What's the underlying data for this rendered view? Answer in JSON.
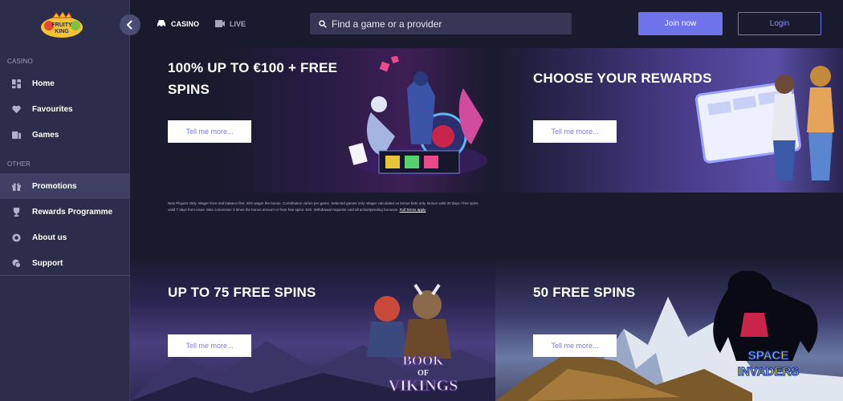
{
  "brand": {
    "logo_text": "FRUITY KING"
  },
  "sidebar": {
    "sections": [
      {
        "label": "CASINO"
      },
      {
        "label": "OTHER"
      }
    ],
    "items": [
      {
        "label": "Home",
        "icon": "grid-icon"
      },
      {
        "label": "Favourites",
        "icon": "heart-icon"
      },
      {
        "label": "Games",
        "icon": "games-icon"
      },
      {
        "label": "Promotions",
        "icon": "gift-icon",
        "active": true
      },
      {
        "label": "Rewards Programme",
        "icon": "trophy-icon"
      },
      {
        "label": "About us",
        "icon": "info-icon"
      },
      {
        "label": "Support",
        "icon": "support-icon"
      }
    ]
  },
  "header": {
    "tabs": [
      {
        "label": "CASINO",
        "icon": "car-icon"
      },
      {
        "label": "LIVE",
        "icon": "live-icon"
      }
    ],
    "search": {
      "placeholder": "Find a game or a provider"
    },
    "join_label": "Join now",
    "login_label": "Login"
  },
  "promos": [
    {
      "title": "100% UP TO €100 + FREE SPINS",
      "button": "Tell me more..."
    },
    {
      "title": "CHOOSE YOUR REWARDS",
      "button": "Tell me more..."
    },
    {
      "title": "UP TO 75 FREE SPINS",
      "button": "Tell me more...",
      "game_logo": "BOOK OF VIKINGS"
    },
    {
      "title": "50 FREE SPINS",
      "button": "Tell me more...",
      "game_logo": "SPACE INVADERS"
    }
  ],
  "terms": {
    "text": "New Players Only. Wager from real balance first. 50X wager the bonus. Contribution varies per game. Selected games only. Wager calculated on bonus bets only. Bonus valid 30 days / free spins valid 7 days from issue. Max conversion 3 times the bonus amount or from free spins: €20. Withdrawal requests void all active/pending bonuses.",
    "link": "Full Terms apply"
  },
  "colors": {
    "sidebar_bg": "#2b2d4b",
    "page_bg": "#1a1a2e",
    "accent": "#6f73ea",
    "search_bg": "#353755"
  }
}
